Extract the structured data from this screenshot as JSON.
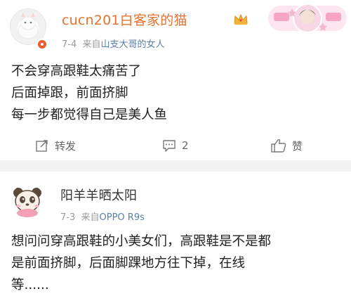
{
  "posts": [
    {
      "username": "cucn201白客家的猫",
      "date": "7-4",
      "source_prefix": "来自",
      "source": "山支大哥的女人",
      "lines": [
        "不会穿高跟鞋太痛苦了",
        "后面掉跟，前面挤脚",
        "每一步都觉得自己是美人鱼"
      ],
      "actions": {
        "repost_label": "转发",
        "comment_count": "2",
        "like_label": "赞"
      }
    },
    {
      "username": "阳羊羊晒太阳",
      "date": "7-3",
      "source_prefix": "来自",
      "source": "OPPO R9s",
      "lines": [
        "想问问穿高跟鞋的小美女们，高跟鞋是不是都",
        "是前面挤脚，后面脚踝地方往下掉，在线",
        "等......"
      ]
    }
  ],
  "colors": {
    "vip_name": "#e8712f",
    "link": "#5b7fa8",
    "meta": "#999999",
    "separator": "#f2f2f2"
  },
  "icons": [
    "repost-icon",
    "comment-icon",
    "like-icon",
    "crown-icon",
    "vip-badge"
  ]
}
